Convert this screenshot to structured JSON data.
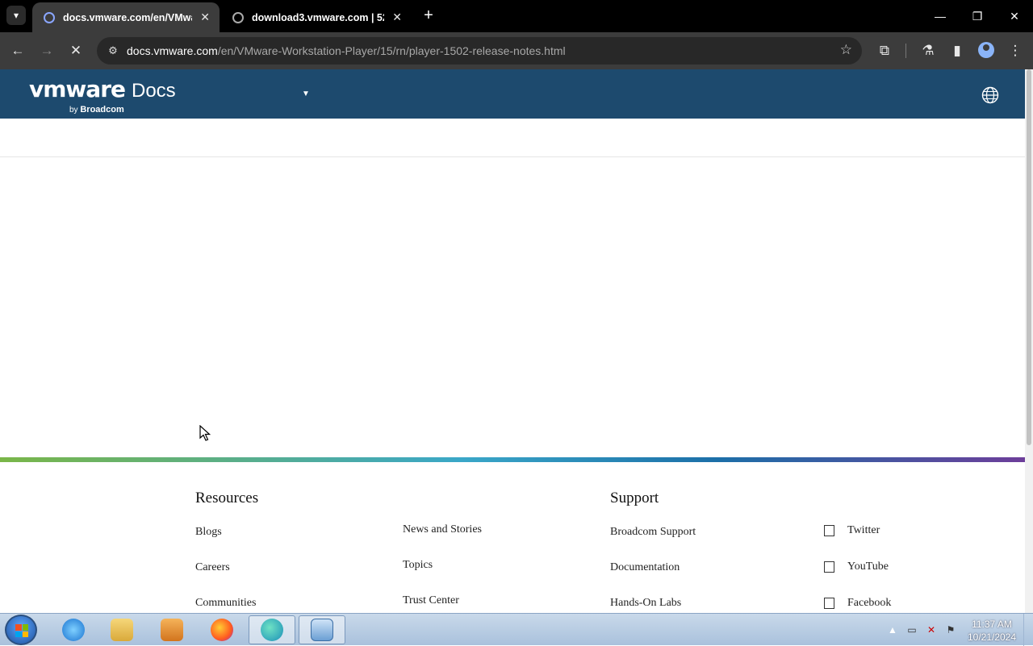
{
  "browser": {
    "tabs": [
      {
        "title": "docs.vmware.com/en/VMware",
        "active": true
      },
      {
        "title": "download3.vmware.com | 522",
        "active": false
      }
    ],
    "new_tab_label": "+",
    "address": {
      "host": "docs.vmware.com",
      "path": "/en/VMware-Workstation-Player/15/rn/player-1502-release-notes.html"
    }
  },
  "site": {
    "logo_brand": "vmware",
    "logo_product": "Docs",
    "logo_by": "by",
    "logo_company": "Broadcom"
  },
  "footer": {
    "resources": {
      "heading": "Resources",
      "col1": [
        "Blogs",
        "Careers",
        "Communities"
      ],
      "col2": [
        "News and Stories",
        "Topics",
        "Trust Center"
      ]
    },
    "support": {
      "heading": "Support",
      "links": [
        "Broadcom Support",
        "Documentation",
        "Hands-On Labs"
      ]
    },
    "social": [
      "Twitter",
      "YouTube",
      "Facebook"
    ]
  },
  "taskbar": {
    "time": "11:37 AM",
    "date": "10/21/2024"
  },
  "colors": {
    "header_bg": "#1d4a6e",
    "browser_chrome": "#3c3c3c",
    "tabstrip": "#000000"
  }
}
